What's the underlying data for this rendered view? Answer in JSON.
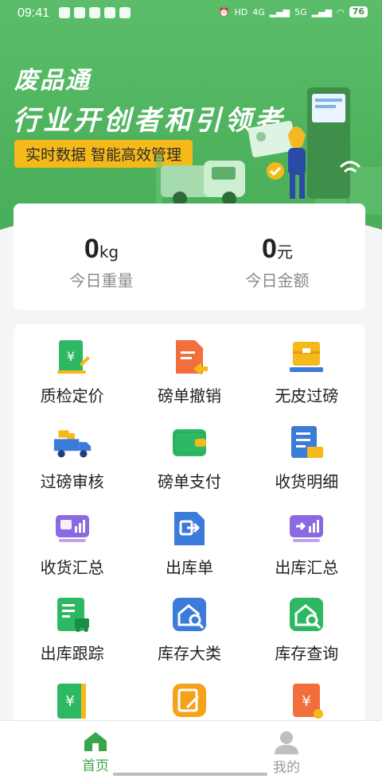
{
  "status_bar": {
    "time": "09:41",
    "network": "4G",
    "network2": "5G",
    "hd": "HD",
    "battery": "76"
  },
  "banner": {
    "brand": "废品通",
    "slogan": "行业开创者和引领者",
    "tagline": "实时数据 智能高效管理"
  },
  "stats": [
    {
      "value": "0",
      "unit": "kg",
      "label": "今日重量"
    },
    {
      "value": "0",
      "unit": "元",
      "label": "今日金额"
    }
  ],
  "menu": [
    {
      "label": "质检定价",
      "icon": "quality-pricing-icon"
    },
    {
      "label": "磅单撤销",
      "icon": "weigh-revoke-icon"
    },
    {
      "label": "无皮过磅",
      "icon": "tareless-weigh-icon"
    },
    {
      "label": "过磅审核",
      "icon": "truck-review-icon"
    },
    {
      "label": "磅单支付",
      "icon": "wallet-icon"
    },
    {
      "label": "收货明细",
      "icon": "receipt-detail-icon"
    },
    {
      "label": "收货汇总",
      "icon": "receipt-summary-icon"
    },
    {
      "label": "出库单",
      "icon": "outbound-order-icon"
    },
    {
      "label": "出库汇总",
      "icon": "outbound-summary-icon"
    },
    {
      "label": "出库跟踪",
      "icon": "outbound-tracking-icon"
    },
    {
      "label": "库存大类",
      "icon": "stock-category-icon"
    },
    {
      "label": "库存查询",
      "icon": "stock-query-icon"
    },
    {
      "label": "",
      "icon": "ledger-icon"
    },
    {
      "label": "",
      "icon": "edit-form-icon"
    },
    {
      "label": "",
      "icon": "bill-icon"
    }
  ],
  "tabs": [
    {
      "label": "首页",
      "icon": "home-icon",
      "active": true
    },
    {
      "label": "我的",
      "icon": "user-icon",
      "active": false
    }
  ],
  "colors": {
    "brand_green": "#4fb35e",
    "accent_yellow": "#f5b91a",
    "active_tab": "#3aa64a"
  }
}
